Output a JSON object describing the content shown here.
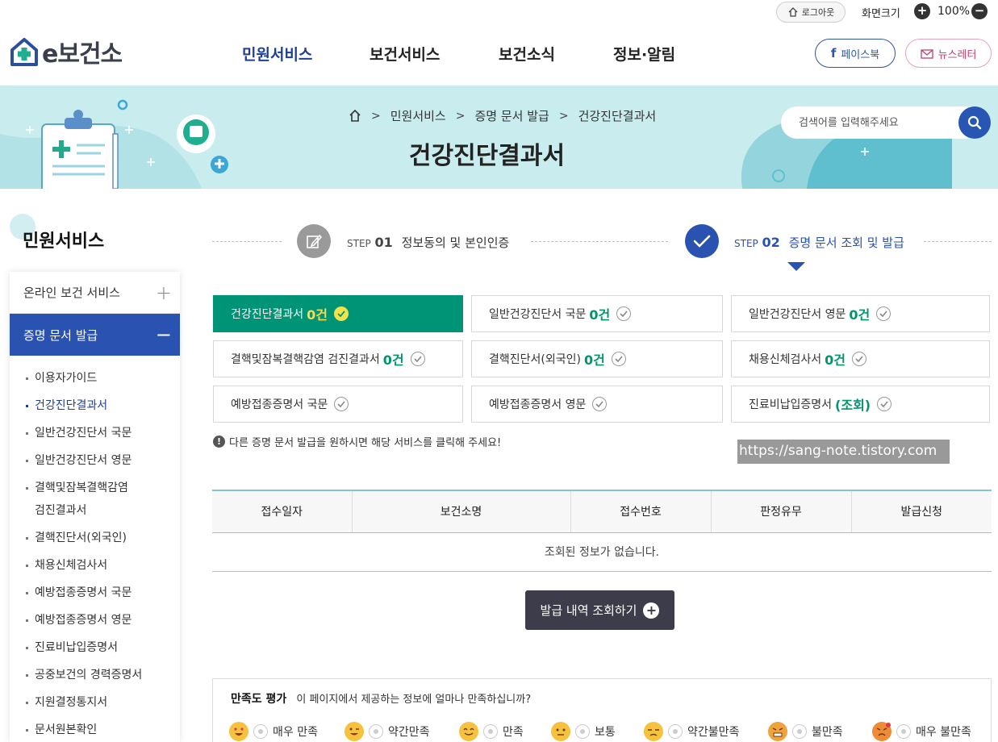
{
  "util": {
    "logout": "로그아웃",
    "zoom_label": "화면크기",
    "zoom_value": "100%"
  },
  "header": {
    "logo": "e보건소",
    "nav": [
      "민원서비스",
      "보건서비스",
      "보건소식",
      "정보·알림"
    ],
    "facebook": "페이스북",
    "newsletter": "뉴스레터"
  },
  "banner": {
    "breadcrumb": [
      "민원서비스",
      "증명 문서 발급",
      "건강진단결과서"
    ],
    "title": "건강진단결과서",
    "search_placeholder": "검색어를 입력해주세요"
  },
  "sidebar": {
    "title": "민원서비스",
    "menu": [
      {
        "label": "온라인 보건 서비스",
        "toggle": "+"
      },
      {
        "label": "증명 문서 발급",
        "toggle": "−"
      }
    ],
    "sub": [
      "이용자가이드",
      "건강진단결과서",
      "일반건강진단서 국문",
      "일반건강진단서 영문",
      "결핵및잠복결핵감염",
      "검진결과서",
      "결핵진단서(외국인)",
      "채용신체검사서",
      "예방접종증명서 국문",
      "예방접종증명서 영문",
      "진료비납입증명서",
      "공중보건의 경력증명서",
      "지원결정통지서",
      "문서원본확인"
    ]
  },
  "steps": [
    {
      "st": "STEP",
      "num": "01",
      "label": "정보동의 및 본인인증"
    },
    {
      "st": "STEP",
      "num": "02",
      "label": "증명 문서 조회 및 발급"
    }
  ],
  "docs": [
    {
      "label": "건강진단결과서",
      "count": "0건"
    },
    {
      "label": "일반건강진단서 국문",
      "count": "0건"
    },
    {
      "label": "일반건강진단서 영문",
      "count": "0건"
    },
    {
      "label": "결핵및잠복결핵감염 검진결과서",
      "count": "0건"
    },
    {
      "label": "결핵진단서(외국인)",
      "count": "0건"
    },
    {
      "label": "채용신체검사서",
      "count": "0건"
    },
    {
      "label": "예방접종증명서 국문",
      "count": ""
    },
    {
      "label": "예방접종증명서 영문",
      "count": ""
    },
    {
      "label": "진료비납입증명서",
      "count": "(조회)"
    }
  ],
  "notice": "다른 증명 문서 발급을 원하시면 해당 서비스를 클릭해 주세요!",
  "watermark": "https://sang-note.tistory.com",
  "table": {
    "headers": [
      "접수일자",
      "보건소명",
      "접수번호",
      "판정유무",
      "발급신청"
    ],
    "empty": "조회된 정보가 없습니다."
  },
  "history_button": "발급 내역 조회하기",
  "survey": {
    "title": "만족도 평가",
    "question": "이 페이지에서 제공하는 정보에 얼마나 만족하십니까?",
    "options": [
      "매우 만족",
      "약간만족",
      "만족",
      "보통",
      "약간불만족",
      "불만족",
      "매우 불만족"
    ]
  },
  "colors": {
    "primary": "#2a52b0",
    "accent_green": "#009476",
    "banner_bg": "#c9ecef"
  }
}
